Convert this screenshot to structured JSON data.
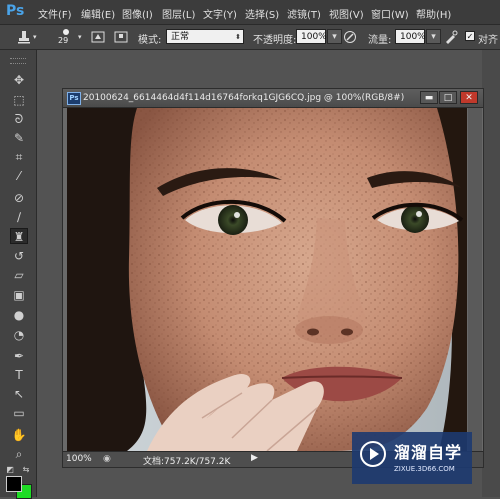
{
  "app": {
    "logo": "Ps"
  },
  "menu": [
    "文件(F)",
    "编辑(E)",
    "图像(I)",
    "图层(L)",
    "文字(Y)",
    "选择(S)",
    "滤镜(T)",
    "视图(V)",
    "窗口(W)",
    "帮助(H)"
  ],
  "options": {
    "brush_size": "29",
    "mode_label": "模式:",
    "mode_value": "正常",
    "opacity_label": "不透明度:",
    "opacity_value": "100%",
    "flow_label": "流量:",
    "flow_value": "100%",
    "align_label": "对齐"
  },
  "document": {
    "title": "20100624_6614464d4f114d16764forkq1GJG6CQ.jpg @ 100%(RGB/8#)",
    "icon": "Ps",
    "zoom": "100%",
    "doc_info": "文档:757.2K/757.2K"
  },
  "watermark": {
    "title": "溜溜自学",
    "url": "ZIXUE.3D66.COM"
  },
  "icons": {
    "tools": [
      "move-tool-icon",
      "marquee-tool-icon",
      "lasso-tool-icon",
      "quick-select-tool-icon",
      "crop-tool-icon",
      "eyedropper-tool-icon",
      "healing-brush-tool-icon",
      "brush-tool-icon",
      "clone-stamp-tool-icon",
      "history-brush-tool-icon",
      "eraser-tool-icon",
      "gradient-tool-icon",
      "blur-tool-icon",
      "dodge-tool-icon",
      "pen-tool-icon",
      "type-tool-icon",
      "path-select-tool-icon",
      "shape-tool-icon",
      "hand-tool-icon",
      "zoom-tool-icon"
    ]
  },
  "colors": {
    "foreground": "#000000",
    "background": "#1edc25",
    "accent": "#4aa3e8"
  }
}
